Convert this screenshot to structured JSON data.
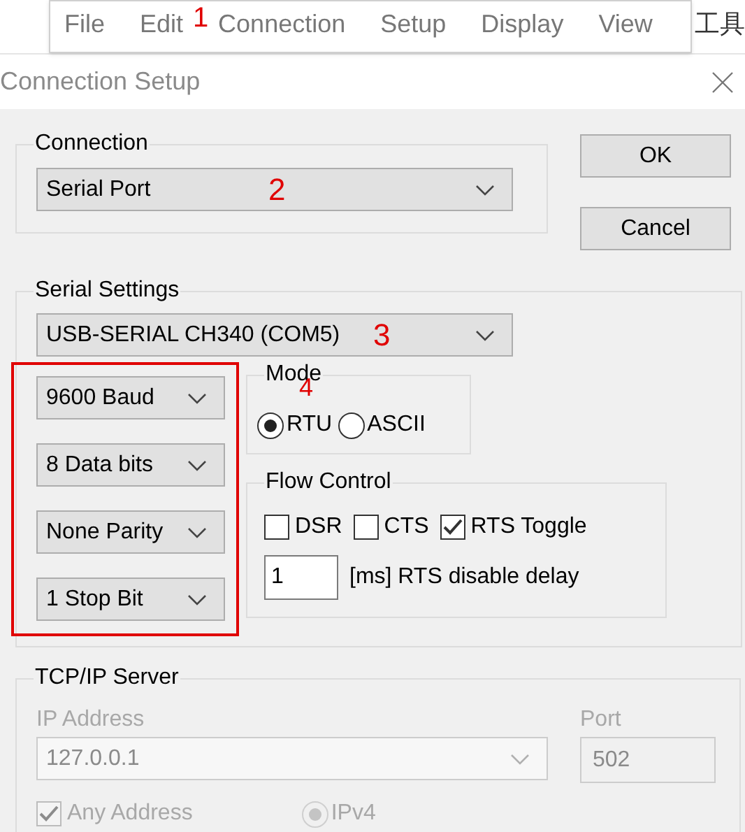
{
  "top_strip": {
    "right_text": "工具"
  },
  "menu": {
    "items": [
      "File",
      "Edit",
      "Connection",
      "Setup",
      "Display",
      "View"
    ],
    "annotation": "1"
  },
  "dialog": {
    "title": "Connection Setup"
  },
  "connection": {
    "label": "Connection",
    "value": "Serial Port",
    "annotation": "2"
  },
  "buttons": [
    "OK",
    "Cancel"
  ],
  "serial": {
    "label": "Serial Settings",
    "port": "USB-SERIAL CH340 (COM5)",
    "port_annotation": "3",
    "params": [
      "9600 Baud",
      "8 Data bits",
      "None Parity",
      "1 Stop Bit"
    ],
    "params_annotation": "4",
    "mode": {
      "label": "Mode",
      "options": [
        {
          "label": "RTU",
          "selected": true
        },
        {
          "label": "ASCII",
          "selected": false
        }
      ]
    },
    "flow": {
      "label": "Flow Control",
      "options": [
        {
          "label": "DSR",
          "checked": false
        },
        {
          "label": "CTS",
          "checked": false
        },
        {
          "label": "RTS Toggle",
          "checked": true
        }
      ],
      "delay_value": "1",
      "delay_label": "[ms] RTS disable delay"
    }
  },
  "tcp": {
    "label": "TCP/IP Server",
    "disabled": true,
    "ip_label": "IP Address",
    "ip": "127.0.0.1",
    "port_label": "Port",
    "port": "502",
    "any_address": {
      "label": "Any Address",
      "checked": true
    },
    "ipv4": {
      "label": "IPv4",
      "selected": true
    }
  }
}
